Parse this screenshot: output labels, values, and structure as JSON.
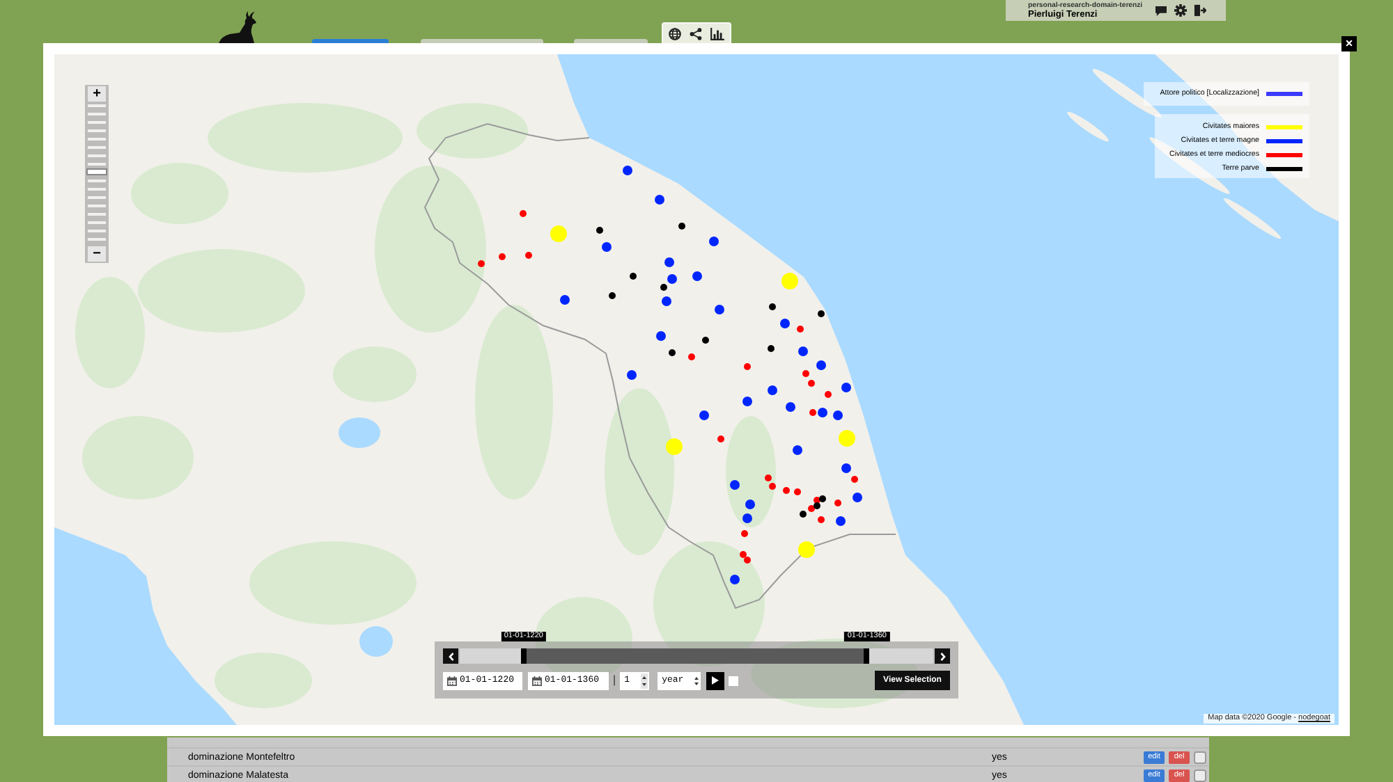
{
  "header": {
    "tabs": [
      {
        "selected": true
      },
      {
        "selected": false
      },
      {
        "selected": false
      }
    ],
    "user": {
      "domain": "personal-research-domain-terenzi",
      "name": "Pierluigi Terenzi"
    }
  },
  "modal": {
    "close": "×",
    "map": {
      "zoom": {
        "zoom_in": "+",
        "zoom_out": "−",
        "level": 0.5
      },
      "legend": {
        "layer": {
          "label": "Attore politico [Localizzazione]",
          "color": "#3a3aff"
        },
        "entries": [
          {
            "label": "Civitates maiores",
            "color": "#ffff00"
          },
          {
            "label": "Civitates et terre magne",
            "color": "#0026ff"
          },
          {
            "label": "Civitates et terre mediocres",
            "color": "#ff0000"
          },
          {
            "label": "Terre parve",
            "color": "#000000"
          }
        ]
      },
      "markers": [
        {
          "kind": "large",
          "color": "#ffff00"
        },
        {
          "kind": "large",
          "color": "#ffff00"
        },
        {
          "kind": "large",
          "color": "#ffff00"
        },
        {
          "kind": "large",
          "color": "#ffff00"
        },
        {
          "kind": "large",
          "color": "#ffff00"
        },
        {
          "kind": "medium",
          "color": "#0026ff"
        },
        {
          "kind": "medium",
          "color": "#0026ff"
        },
        {
          "kind": "medium",
          "color": "#0026ff"
        },
        {
          "kind": "medium",
          "color": "#0026ff"
        },
        {
          "kind": "medium",
          "color": "#0026ff"
        },
        {
          "kind": "medium",
          "color": "#0026ff"
        },
        {
          "kind": "medium",
          "color": "#0026ff"
        },
        {
          "kind": "medium",
          "color": "#0026ff"
        },
        {
          "kind": "medium",
          "color": "#0026ff"
        },
        {
          "kind": "medium",
          "color": "#0026ff"
        },
        {
          "kind": "medium",
          "color": "#0026ff"
        },
        {
          "kind": "medium",
          "color": "#0026ff"
        },
        {
          "kind": "medium",
          "color": "#0026ff"
        },
        {
          "kind": "medium",
          "color": "#0026ff"
        },
        {
          "kind": "medium",
          "color": "#0026ff"
        },
        {
          "kind": "medium",
          "color": "#0026ff"
        },
        {
          "kind": "medium",
          "color": "#0026ff"
        },
        {
          "kind": "medium",
          "color": "#0026ff"
        },
        {
          "kind": "medium",
          "color": "#0026ff"
        },
        {
          "kind": "medium",
          "color": "#0026ff"
        },
        {
          "kind": "medium",
          "color": "#0026ff"
        },
        {
          "kind": "medium",
          "color": "#0026ff"
        },
        {
          "kind": "medium",
          "color": "#0026ff"
        },
        {
          "kind": "medium",
          "color": "#0026ff"
        },
        {
          "kind": "medium",
          "color": "#0026ff"
        },
        {
          "kind": "medium",
          "color": "#0026ff"
        },
        {
          "kind": "medium",
          "color": "#0026ff"
        },
        {
          "kind": "medium",
          "color": "#0026ff"
        },
        {
          "kind": "medium",
          "color": "#0026ff"
        },
        {
          "kind": "medium",
          "color": "#0026ff"
        },
        {
          "kind": "small",
          "color": "#ff0000"
        },
        {
          "kind": "small",
          "color": "#ff0000"
        },
        {
          "kind": "small",
          "color": "#ff0000"
        },
        {
          "kind": "small",
          "color": "#ff0000"
        },
        {
          "kind": "small",
          "color": "#ff0000"
        },
        {
          "kind": "small",
          "color": "#ff0000"
        },
        {
          "kind": "small",
          "color": "#ff0000"
        },
        {
          "kind": "small",
          "color": "#ff0000"
        },
        {
          "kind": "small",
          "color": "#ff0000"
        },
        {
          "kind": "small",
          "color": "#ff0000"
        },
        {
          "kind": "small",
          "color": "#ff0000"
        },
        {
          "kind": "small",
          "color": "#ff0000"
        },
        {
          "kind": "small",
          "color": "#ff0000"
        },
        {
          "kind": "small",
          "color": "#ff0000"
        },
        {
          "kind": "small",
          "color": "#ff0000"
        },
        {
          "kind": "small",
          "color": "#ff0000"
        },
        {
          "kind": "small",
          "color": "#ff0000"
        },
        {
          "kind": "small",
          "color": "#ff0000"
        },
        {
          "kind": "small",
          "color": "#ff0000"
        },
        {
          "kind": "small",
          "color": "#ff0000"
        },
        {
          "kind": "small",
          "color": "#ff0000"
        },
        {
          "kind": "small",
          "color": "#ff0000"
        },
        {
          "kind": "small",
          "color": "#ff0000"
        },
        {
          "kind": "small",
          "color": "#ff0000"
        },
        {
          "kind": "small",
          "color": "#000000"
        },
        {
          "kind": "small",
          "color": "#000000"
        },
        {
          "kind": "small",
          "color": "#000000"
        },
        {
          "kind": "small",
          "color": "#000000"
        },
        {
          "kind": "small",
          "color": "#000000"
        },
        {
          "kind": "small",
          "color": "#000000"
        },
        {
          "kind": "small",
          "color": "#000000"
        },
        {
          "kind": "small",
          "color": "#000000"
        },
        {
          "kind": "small",
          "color": "#000000"
        },
        {
          "kind": "small",
          "color": "#000000"
        },
        {
          "kind": "small",
          "color": "#000000"
        },
        {
          "kind": "small",
          "color": "#000000"
        },
        {
          "kind": "small",
          "color": "#000000"
        }
      ],
      "attribution": {
        "text": "Map data ©2020 Google -",
        "link": "nodegoat"
      }
    },
    "timeline": {
      "start": {
        "label": "01-01-1220",
        "level": 0.135
      },
      "end": {
        "label": "01-01-1360",
        "level": 0.86
      },
      "date_from": "01-01-1220",
      "date_to": "01-01-1360",
      "separator": "|",
      "step": "1",
      "unit": "year",
      "checkbox": {
        "checked": false
      },
      "view_button": "View Selection"
    }
  },
  "table": {
    "rows": [
      {
        "name": "dominazione Montefeltro",
        "value": "yes",
        "edit": "edit",
        "delete": "del",
        "checked": false
      },
      {
        "name": "dominazione Malatesta",
        "value": "yes",
        "edit": "edit",
        "delete": "del",
        "checked": false
      }
    ]
  }
}
